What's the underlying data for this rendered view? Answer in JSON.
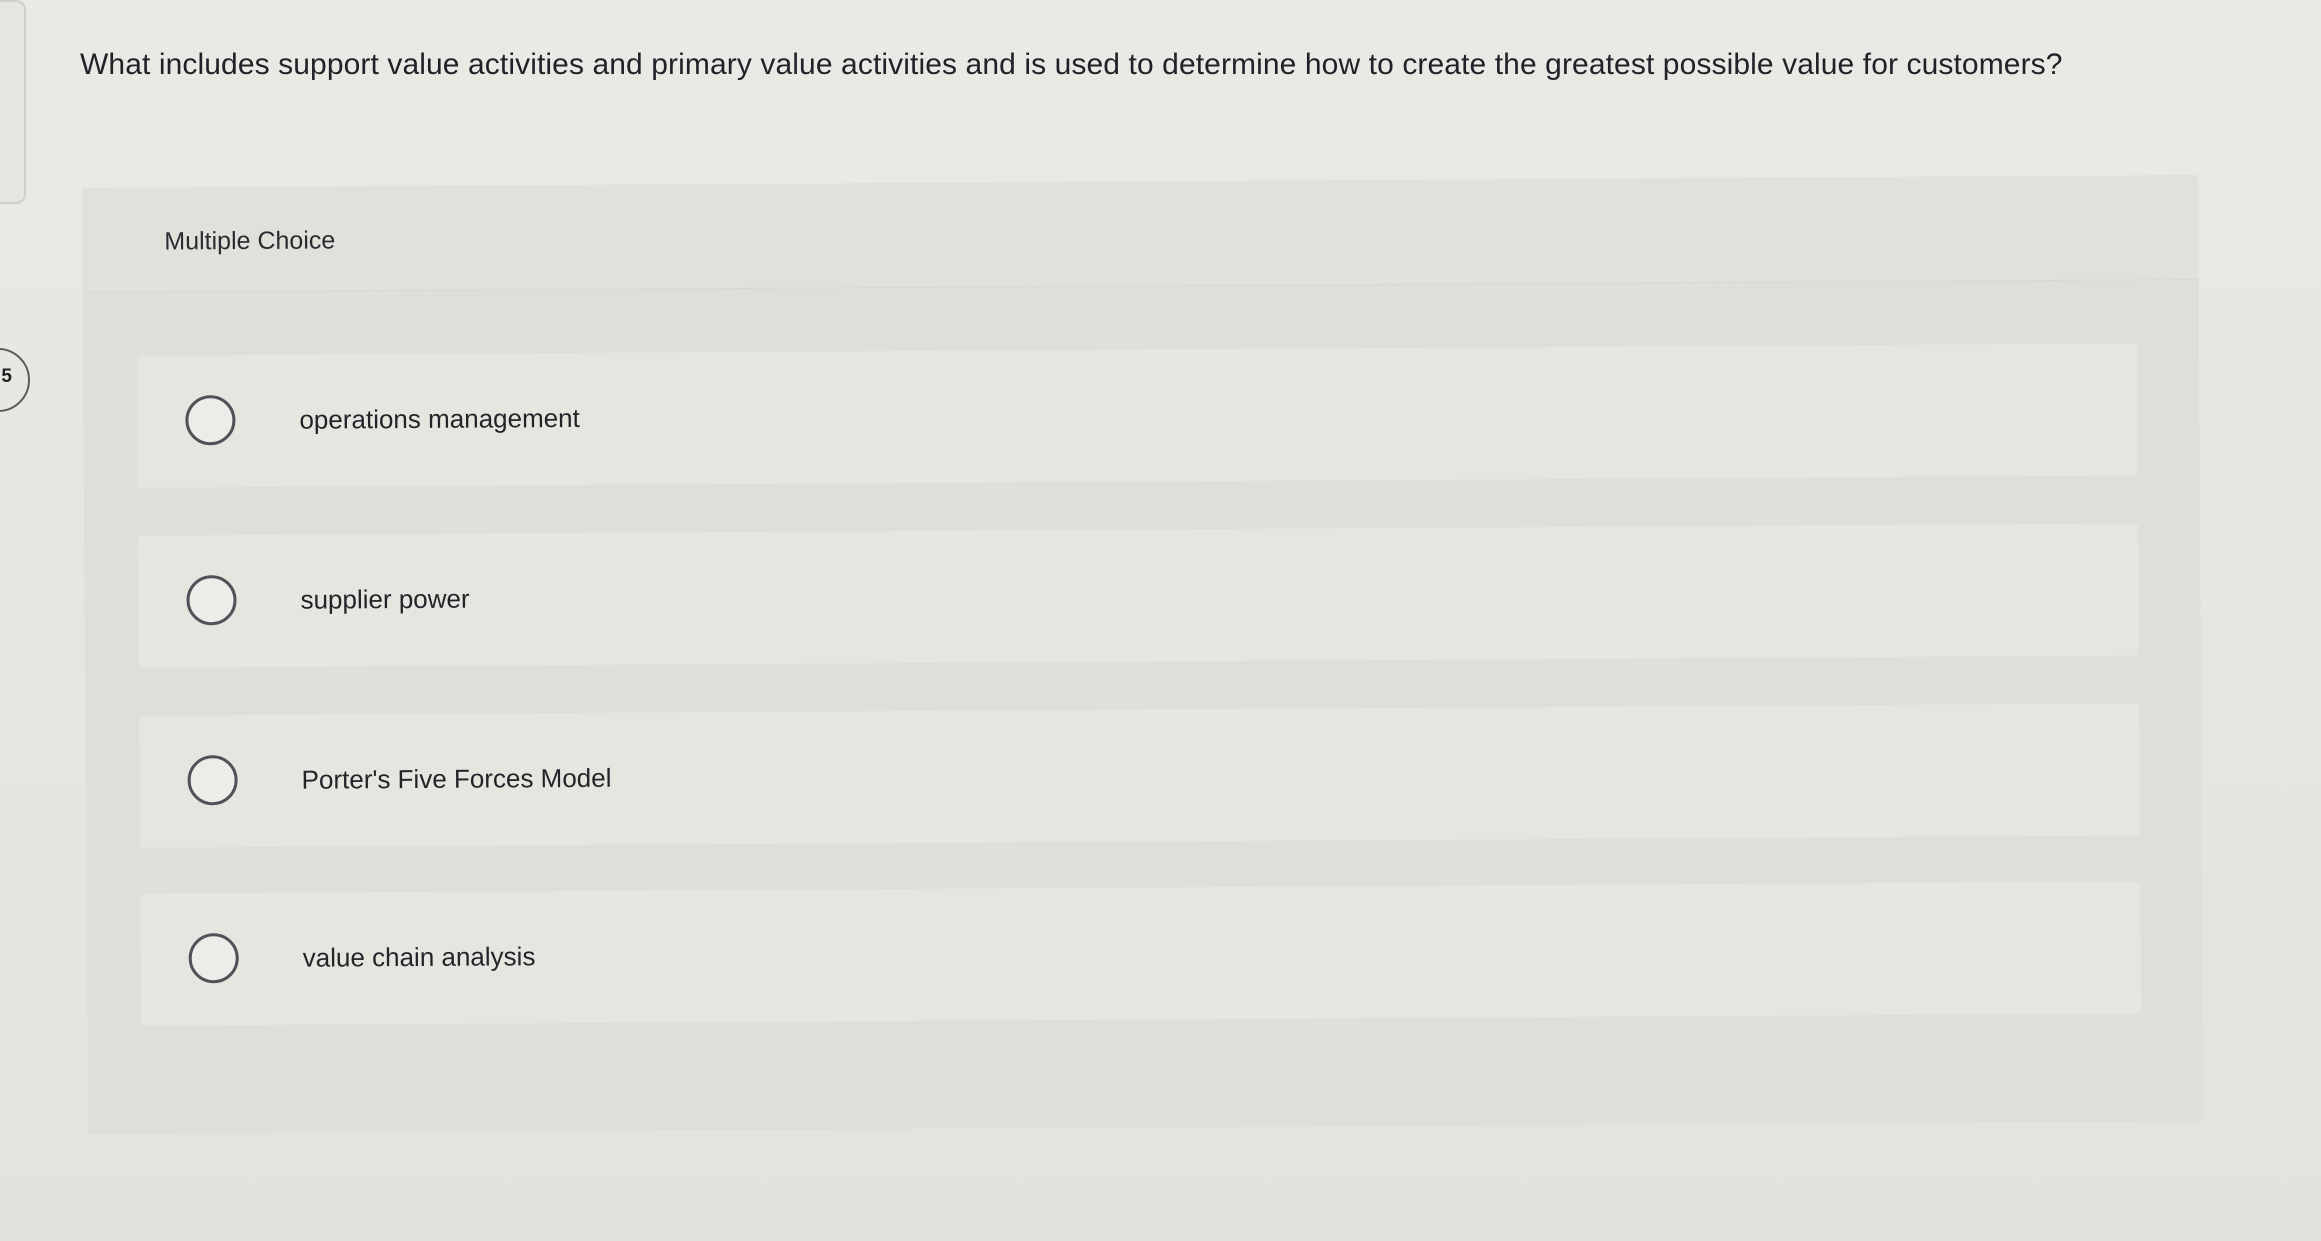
{
  "question": {
    "number": "5",
    "text": "What includes support value activities and primary value activities and is used to determine how to create the greatest possible value for customers?"
  },
  "choices": {
    "header": "Multiple Choice",
    "options": [
      {
        "label": "operations management"
      },
      {
        "label": "supplier power"
      },
      {
        "label": "Porter's Five Forces Model"
      },
      {
        "label": "value chain analysis"
      }
    ]
  }
}
